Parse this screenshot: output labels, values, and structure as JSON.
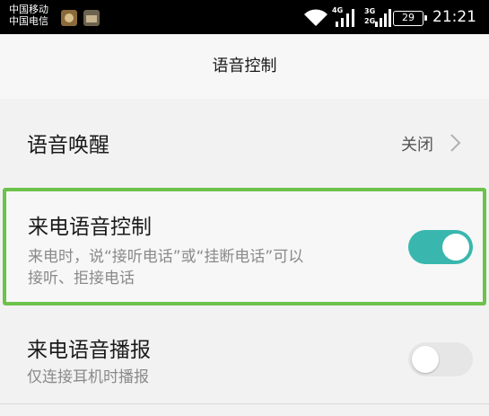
{
  "status_bar": {
    "carrier_1": "中国移动",
    "carrier_2": "中国电信",
    "notification_icons": [
      "game-app-icon",
      "photo-app-icon"
    ],
    "signal_1_label": "4G",
    "signal_2_label_top": "3G",
    "signal_2_label_bottom": "2G",
    "battery_level": "29",
    "time": "21:21"
  },
  "header": {
    "title": "语音控制"
  },
  "settings": {
    "voice_wakeup": {
      "title": "语音唤醒",
      "value": "关闭"
    },
    "incoming_call_voice_control": {
      "title": "来电语音控制",
      "description_line_1": "来电时，说“接听电话”或“挂断电话”可以",
      "description_line_2": "接听、拒接电话",
      "enabled": true
    },
    "incoming_call_announcement": {
      "title": "来电语音播报",
      "description": "仅连接耳机时播报",
      "enabled": false
    }
  },
  "colors": {
    "toggle_on": "#39b7ae",
    "toggle_off": "#e6e6e6",
    "highlight_border": "#6cc24a"
  }
}
